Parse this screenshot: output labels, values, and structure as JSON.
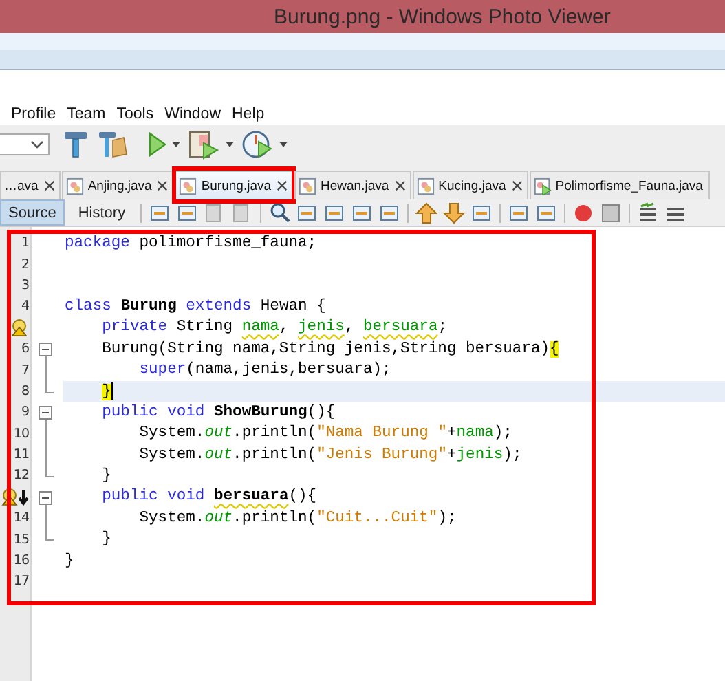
{
  "window": {
    "title": "Burung.png - Windows Photo Viewer"
  },
  "menu": [
    {
      "label": "Profile"
    },
    {
      "label": "Team"
    },
    {
      "label": "Tools"
    },
    {
      "label": "Window"
    },
    {
      "label": "Help"
    }
  ],
  "tabs": [
    {
      "label": "…ava",
      "selected": false,
      "highlighted": false,
      "kind": "none",
      "closable": true
    },
    {
      "label": "Anjing.java",
      "selected": false,
      "highlighted": false,
      "kind": "class",
      "closable": true
    },
    {
      "label": "Burung.java",
      "selected": true,
      "highlighted": true,
      "kind": "class",
      "closable": true
    },
    {
      "label": "Hewan.java",
      "selected": false,
      "highlighted": false,
      "kind": "class",
      "closable": true
    },
    {
      "label": "Kucing.java",
      "selected": false,
      "highlighted": false,
      "kind": "class",
      "closable": true
    },
    {
      "label": "Polimorfisme_Fauna.java",
      "selected": false,
      "highlighted": false,
      "kind": "main",
      "closable": false
    }
  ],
  "view_tabs": [
    {
      "label": "Source",
      "selected": true
    },
    {
      "label": "History",
      "selected": false
    }
  ],
  "editor": {
    "highlighted": true,
    "lines": [
      {
        "number": "1",
        "tokens": [
          {
            "text": "package",
            "kind": "keyword"
          },
          {
            "text": " polimorfisme_fauna;",
            "kind": "plain"
          }
        ]
      },
      {
        "number": "2"
      },
      {
        "number": "3"
      },
      {
        "number": "4",
        "tokens": [
          {
            "text": "class",
            "kind": "keyword"
          },
          {
            "text": " Burung",
            "kind": "decl"
          },
          {
            "text": " extends",
            "kind": "keyword"
          },
          {
            "text": " Hewan {",
            "kind": "plain"
          }
        ]
      },
      {
        "warning": true,
        "tokens": [
          {
            "text": "    private",
            "kind": "keyword"
          },
          {
            "text": " String ",
            "kind": "plain"
          },
          {
            "text": "nama",
            "kind": "field",
            "warn": true
          },
          {
            "text": ", ",
            "kind": "plain"
          },
          {
            "text": "jenis",
            "kind": "field",
            "warn": true
          },
          {
            "text": ", ",
            "kind": "plain"
          },
          {
            "text": "bersuara",
            "kind": "field",
            "warn": true
          },
          {
            "text": ";",
            "kind": "plain"
          }
        ]
      },
      {
        "number": "6",
        "fold_start": true,
        "tokens": [
          {
            "text": "    Burung(String nama,String jenis,String bersuara)",
            "kind": "plain"
          },
          {
            "text": "{",
            "kind": "match"
          }
        ]
      },
      {
        "number": "7",
        "fold_inside": true,
        "tokens": [
          {
            "text": "        super",
            "kind": "keyword"
          },
          {
            "text": "(nama,jenis,bersuara);",
            "kind": "plain"
          }
        ]
      },
      {
        "number": "8",
        "fold_end": true,
        "current": true,
        "cursor": true,
        "tokens": [
          {
            "text": "    }",
            "kind": "match"
          }
        ]
      },
      {
        "number": "9",
        "fold_start": true,
        "tokens": [
          {
            "text": "    public",
            "kind": "keyword"
          },
          {
            "text": " void",
            "kind": "keyword"
          },
          {
            "text": " ShowBurung",
            "kind": "decl"
          },
          {
            "text": "(){",
            "kind": "plain"
          }
        ]
      },
      {
        "number": "10",
        "fold_inside": true,
        "tokens": [
          {
            "text": "        System.",
            "kind": "plain"
          },
          {
            "text": "out",
            "kind": "static"
          },
          {
            "text": ".println(",
            "kind": "plain"
          },
          {
            "text": "\"Nama Burung \"",
            "kind": "string"
          },
          {
            "text": "+",
            "kind": "plain"
          },
          {
            "text": "nama",
            "kind": "field"
          },
          {
            "text": ");",
            "kind": "plain"
          }
        ]
      },
      {
        "number": "11",
        "fold_inside": true,
        "tokens": [
          {
            "text": "        System.",
            "kind": "plain"
          },
          {
            "text": "out",
            "kind": "static"
          },
          {
            "text": ".println(",
            "kind": "plain"
          },
          {
            "text": "\"Jenis Burung\"",
            "kind": "string"
          },
          {
            "text": "+",
            "kind": "plain"
          },
          {
            "text": "jenis",
            "kind": "field"
          },
          {
            "text": ");",
            "kind": "plain"
          }
        ]
      },
      {
        "number": "12",
        "fold_end": true,
        "tokens": [
          {
            "text": "    }",
            "kind": "plain"
          }
        ]
      },
      {
        "warning": true,
        "overrides": true,
        "fold_start": true,
        "tokens": [
          {
            "text": "    public",
            "kind": "keyword"
          },
          {
            "text": " void",
            "kind": "keyword"
          },
          {
            "text": " bersuara",
            "kind": "decl",
            "warn": true
          },
          {
            "text": "(){",
            "kind": "plain"
          }
        ]
      },
      {
        "number": "14",
        "fold_inside": true,
        "tokens": [
          {
            "text": "        System.",
            "kind": "plain"
          },
          {
            "text": "out",
            "kind": "static"
          },
          {
            "text": ".println(",
            "kind": "plain"
          },
          {
            "text": "\"Cuit...Cuit\"",
            "kind": "string"
          },
          {
            "text": ");",
            "kind": "plain"
          }
        ]
      },
      {
        "number": "15",
        "fold_end": true,
        "tokens": [
          {
            "text": "    }",
            "kind": "plain"
          }
        ]
      },
      {
        "number": "16",
        "tokens": [
          {
            "text": "}",
            "kind": "plain"
          }
        ]
      },
      {
        "number": "17"
      }
    ]
  }
}
